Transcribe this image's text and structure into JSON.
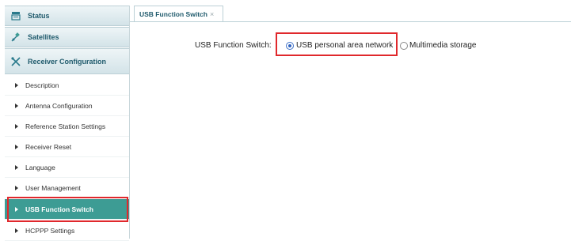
{
  "sidebar": {
    "sections": [
      {
        "label": "Status",
        "icon": "status-icon"
      },
      {
        "label": "Satellites",
        "icon": "satellite-icon"
      },
      {
        "label": "Receiver Configuration",
        "icon": "tools-icon"
      }
    ],
    "items": [
      {
        "label": "Description"
      },
      {
        "label": "Antenna Configuration"
      },
      {
        "label": "Reference Station Settings"
      },
      {
        "label": "Receiver Reset"
      },
      {
        "label": "Language"
      },
      {
        "label": "User Management"
      },
      {
        "label": "USB Function Switch",
        "active": true
      },
      {
        "label": "HCPPP Settings"
      }
    ]
  },
  "tabs": [
    {
      "label": "USB Function Switch",
      "close": "×"
    }
  ],
  "form": {
    "label": "USB Function Switch:",
    "options": [
      {
        "label": "USB personal area network",
        "selected": true
      },
      {
        "label": "Multimedia storage",
        "selected": false
      }
    ]
  },
  "colors": {
    "active_item": "#3d9c94",
    "highlight_box": "#e0282c",
    "header_text": "#1f5a6c"
  }
}
